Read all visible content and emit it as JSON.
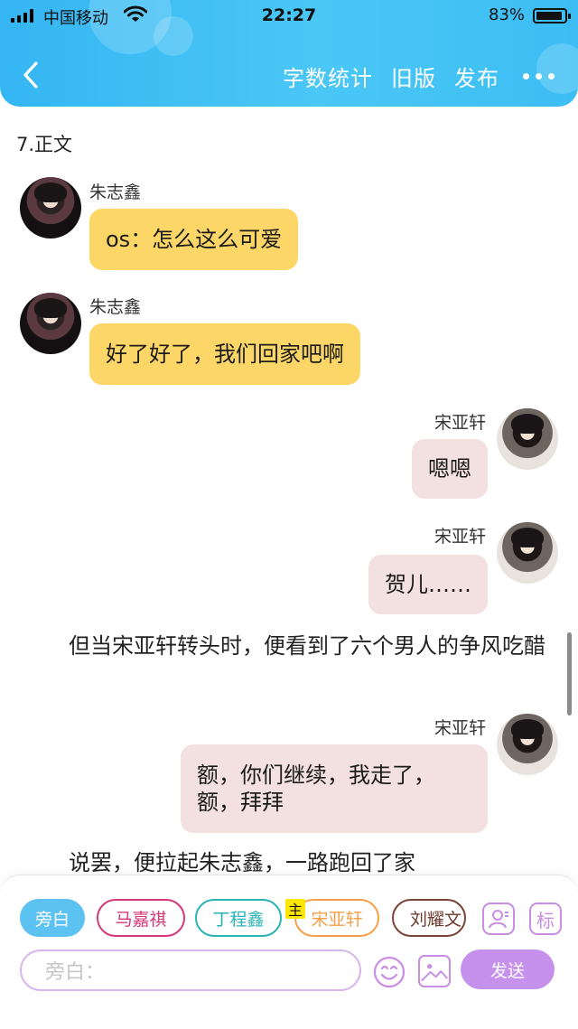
{
  "status_bar": {
    "carrier": "中国移动",
    "time": "22:27",
    "battery": "83%",
    "battery_level": 0.83
  },
  "header": {
    "back_icon": "chevron-left-icon",
    "actions": {
      "word_count": "字数统计",
      "old_version": "旧版",
      "publish": "发布"
    },
    "more_icon": "more-dots-icon"
  },
  "content": {
    "section_title": "7.正文",
    "messages": [
      {
        "side": "left",
        "name": "朱志鑫",
        "text": "os：怎么这么可爱",
        "color": "#fcd666"
      },
      {
        "side": "left",
        "name": "朱志鑫",
        "text": "好了好了，我们回家吧啊",
        "color": "#fcd666"
      },
      {
        "side": "right",
        "name": "宋亚轩",
        "text": "嗯嗯",
        "color": "#f3e0e0"
      },
      {
        "side": "right",
        "name": "宋亚轩",
        "text": "贺儿……",
        "color": "#f3e0e0"
      },
      {
        "side": "right",
        "name": "宋亚轩",
        "text_line1": "额，你们继续，我走了，",
        "text_line2": "额，拜拜",
        "color": "#f3e0e0"
      }
    ],
    "narration_1": "但当宋亚轩转头时，便看到了六个男人的争风吃醋",
    "narration_2": "说罢，便拉起朱志鑫，一路跑回了家"
  },
  "composer": {
    "roles": [
      "旁白",
      "马嘉祺",
      "丁程鑫",
      "宋亚轩",
      "刘耀文"
    ],
    "host_badge": "主",
    "person_icon": "person-chat-icon",
    "mark_label": "标",
    "input_placeholder": "旁白：",
    "emoji_icon": "smiley-icon",
    "image_icon": "image-icon",
    "send_label": "发送"
  }
}
